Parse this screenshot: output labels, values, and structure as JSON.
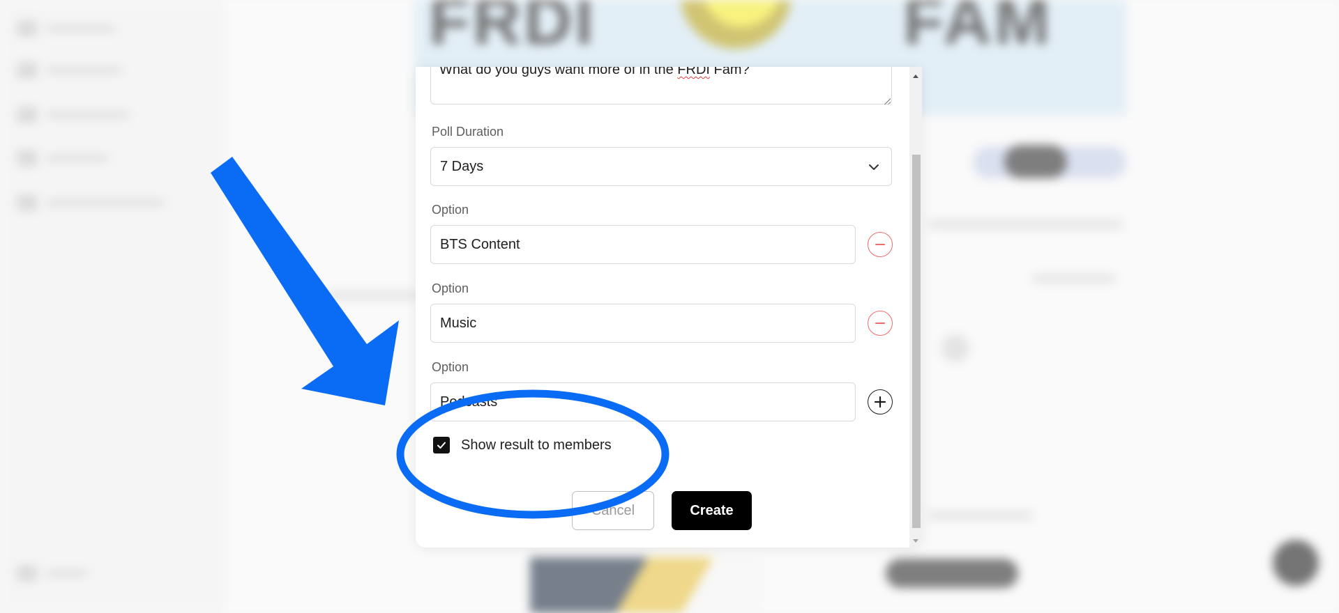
{
  "modal": {
    "question_text": "What do you guys want more of in the FRDI Fam?",
    "duration": {
      "label": "Poll Duration",
      "value": "7 Days"
    },
    "options": [
      {
        "label": "Option",
        "value": "BTS Content",
        "action": "remove"
      },
      {
        "label": "Option",
        "value": "Music",
        "action": "remove"
      },
      {
        "label": "Option",
        "value": "Podcasts",
        "action": "add"
      }
    ],
    "show_results": {
      "label": "Show result to members",
      "checked": true
    },
    "buttons": {
      "cancel": "Cancel",
      "create": "Create"
    }
  },
  "annotation": {
    "color": "#0a6cf5",
    "arrow_icon": "arrow-down-right-icon",
    "highlight": "ellipse"
  },
  "colors": {
    "remove_button": "#f06a6a",
    "primary_button": "#000000"
  }
}
